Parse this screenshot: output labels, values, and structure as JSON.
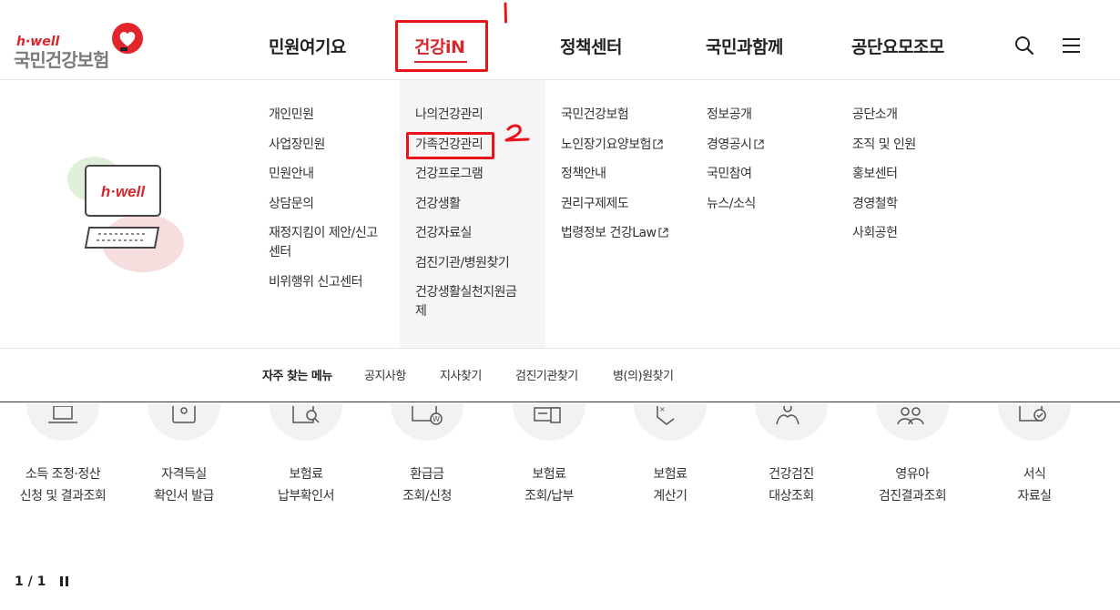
{
  "logo": {
    "brand": "h·well",
    "name": "국민건강보험"
  },
  "gnb": [
    {
      "label": "민원여기요"
    },
    {
      "label": "건강iN",
      "active": true
    },
    {
      "label": "정책센터"
    },
    {
      "label": "국민과함께"
    },
    {
      "label": "공단요모조모"
    }
  ],
  "header_icons": [
    "search-icon",
    "menu-icon"
  ],
  "annotations": {
    "mark1": "1",
    "mark2": "2"
  },
  "illustration": {
    "screen_text": "h·well"
  },
  "mega_menu": {
    "col1": [
      "개인민원",
      "사업장민원",
      "민원안내",
      "상담문의",
      "재정지킴이 제안/신고",
      "센터",
      "비위행위 신고센터"
    ],
    "col2": [
      "나의건강관리",
      "가족건강관리",
      "건강프로그램",
      "건강생활",
      "건강자료실",
      "검진기관/병원찾기",
      "건강생활실천지원금",
      "제"
    ],
    "col3": [
      "국민건강보험",
      "노인장기요양보험",
      "정책안내",
      "권리구제제도",
      "법령정보 건강Law"
    ],
    "col4": [
      "정보공개",
      "경영공시",
      "국민참여",
      "뉴스/소식"
    ],
    "col5": [
      "공단소개",
      "조직 및 인원",
      "홍보센터",
      "경영철학",
      "사회공헌"
    ]
  },
  "quick_menu": {
    "title": "자주 찾는 메뉴",
    "links": [
      "공지사항",
      "지사찾기",
      "검진기관찾기",
      "병(의)원찾기"
    ]
  },
  "services": [
    {
      "line1": "소득 조정·정산",
      "line2": "신청 및 결과조회"
    },
    {
      "line1": "자격득실",
      "line2": "확인서 발급"
    },
    {
      "line1": "보험료",
      "line2": "납부확인서"
    },
    {
      "line1": "환급금",
      "line2": "조회/신청"
    },
    {
      "line1": "보험료",
      "line2": "조회/납부"
    },
    {
      "line1": "보험료",
      "line2": "계산기"
    },
    {
      "line1": "건강검진",
      "line2": "대상조회"
    },
    {
      "line1": "영유아",
      "line2": "검진결과조회"
    },
    {
      "line1": "서식",
      "line2": "자료실"
    }
  ],
  "pager": {
    "text": "1 / 1"
  },
  "colors": {
    "accent": "#d9262c",
    "annotation": "#e8141c",
    "menu_bg": "#f5f5f5"
  }
}
